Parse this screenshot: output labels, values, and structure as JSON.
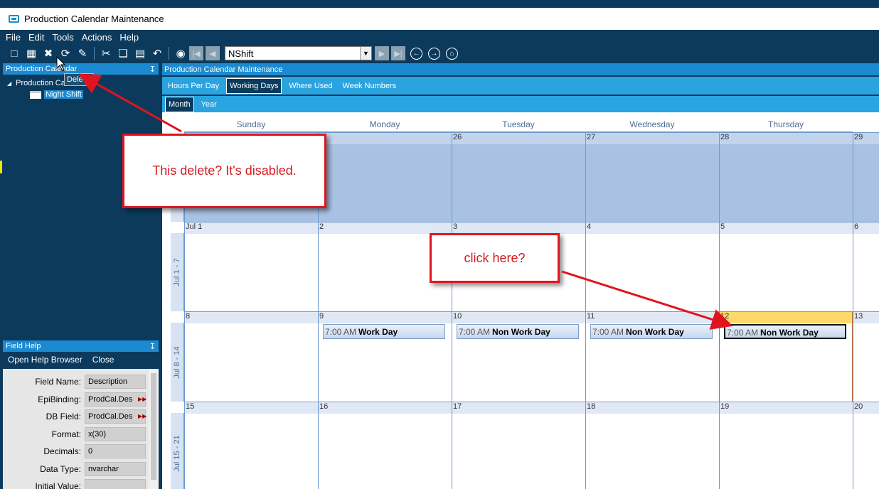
{
  "window": {
    "title": "Production Calendar Maintenance"
  },
  "menu": [
    "File",
    "Edit",
    "Tools",
    "Actions",
    "Help"
  ],
  "toolbar": {
    "combo_value": "NShift"
  },
  "left_panel": {
    "header": "Production Calendar",
    "tree_root": "Production Calendar",
    "tree_child": "Night Shift",
    "tooltip": "Dele"
  },
  "field_help": {
    "header": "Field Help",
    "links": [
      "Open Help Browser",
      "Close"
    ],
    "rows": [
      {
        "label": "Field Name:",
        "value": "Description",
        "arrow": false
      },
      {
        "label": "EpiBinding:",
        "value": "ProdCal.Des",
        "arrow": true
      },
      {
        "label": "DB Field:",
        "value": "ProdCal.Des",
        "arrow": true
      },
      {
        "label": "Format:",
        "value": "x(30)",
        "arrow": false
      },
      {
        "label": "Decimals:",
        "value": "0",
        "arrow": false
      },
      {
        "label": "Data Type:",
        "value": "nvarchar",
        "arrow": false
      },
      {
        "label": "Initial Value:",
        "value": "",
        "arrow": false
      }
    ]
  },
  "main": {
    "header": "Production Calendar Maintenance",
    "tabs": [
      "Hours Per Day",
      "Working Days",
      "Where Used",
      "Week Numbers"
    ],
    "active_tab": 1,
    "subtabs": [
      "Month",
      "Year"
    ],
    "active_subtab": 0
  },
  "calendar": {
    "weekdays": [
      "Sunday",
      "Monday",
      "Tuesday",
      "Wednesday",
      "Thursday"
    ],
    "weeks": [
      {
        "label": "",
        "shaded": true,
        "days": [
          "",
          "",
          "26",
          "27",
          "28",
          "29"
        ],
        "events": []
      },
      {
        "label": "Jul 1 - 7",
        "shaded": false,
        "days": [
          "Jul 1",
          "2",
          "3",
          "4",
          "5",
          "6"
        ],
        "events": []
      },
      {
        "label": "Jul 8 - 14",
        "shaded": false,
        "days": [
          "8",
          "9",
          "10",
          "11",
          "12",
          "13"
        ],
        "today": 4,
        "events": [
          {
            "day": 1,
            "time": "7:00 AM",
            "title": "Work Day",
            "selected": false
          },
          {
            "day": 2,
            "time": "7:00 AM",
            "title": "Non Work Day",
            "selected": false
          },
          {
            "day": 3,
            "time": "7:00 AM",
            "title": "Non Work Day",
            "selected": false
          },
          {
            "day": 4,
            "time": "7:00 AM",
            "title": "Non Work Day",
            "selected": true
          }
        ]
      },
      {
        "label": "Jul 15 - 21",
        "shaded": false,
        "days": [
          "15",
          "16",
          "17",
          "18",
          "19",
          "20"
        ],
        "events": []
      }
    ]
  },
  "annotations": {
    "delete_callout": "This delete? It's disabled.",
    "click_callout": "click here?",
    "color": "#e0141e"
  }
}
